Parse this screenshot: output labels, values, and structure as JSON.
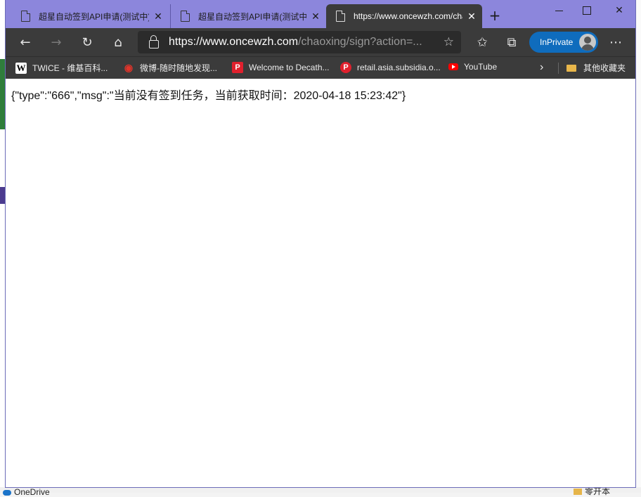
{
  "tabs": [
    {
      "title": "超星自动签到API申请(测试中)",
      "active": false
    },
    {
      "title": "超星自动签到API申请(测试中)",
      "active": false
    },
    {
      "title": "https://www.oncewzh.com/chaoxing/sign?action=",
      "active": true
    }
  ],
  "address_bar": {
    "host": "https://www.oncewzh.com",
    "path": "/chaoxing/sign?action=..."
  },
  "inprivate_label": "InPrivate",
  "favorites": [
    {
      "label": "TWICE - 维基百科...",
      "icon": "wikipedia-icon"
    },
    {
      "label": "微博-随时随地发现...",
      "icon": "weibo-icon"
    },
    {
      "label": "Welcome to Decath...",
      "icon": "decathlon-icon"
    },
    {
      "label": "retail.asia.subsidia.o...",
      "icon": "pinterest-like-icon"
    },
    {
      "label": "YouTube",
      "icon": "youtube-icon"
    }
  ],
  "other_favorites_label": "其他收藏夹",
  "page_body_text": "{\"type\":\"666\",\"msg\":\"当前没有签到任务，当前获取时间：2020-04-18 15:23:42\"}",
  "background": {
    "onedrive_label": "OneDrive",
    "right_item_label": "零开本"
  },
  "colors": {
    "titlebar": "#8c86dc",
    "toolbar": "#3b3b3b",
    "inprivate": "#0f6cbd"
  }
}
